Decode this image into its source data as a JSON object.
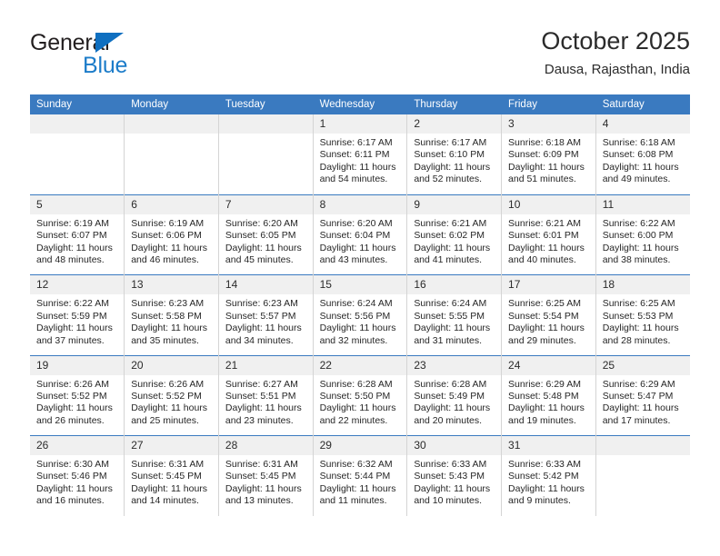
{
  "brand": {
    "name_top": "General",
    "name_bottom": "Blue",
    "triangle_color": "#0f6fc0",
    "text_color": "#231f20",
    "blue_text_color": "#1c7cc9"
  },
  "header": {
    "title": "October 2025",
    "subtitle": "Dausa, Rajasthan, India"
  },
  "theme": {
    "header_row_bg": "#3a7ac0",
    "header_row_text": "#ffffff",
    "daynum_bg": "#f0f0f0",
    "cell_bg": "#ffffff",
    "row_separator": "#3a7ac0",
    "cell_divider": "#d4d4d4"
  },
  "weekday_headers": [
    "Sunday",
    "Monday",
    "Tuesday",
    "Wednesday",
    "Thursday",
    "Friday",
    "Saturday"
  ],
  "labels": {
    "sunrise_prefix": "Sunrise:",
    "sunset_prefix": "Sunset:",
    "daylight_prefix": "Daylight:"
  },
  "weeks": [
    [
      {
        "day": "",
        "empty": true
      },
      {
        "day": "",
        "empty": true
      },
      {
        "day": "",
        "empty": true
      },
      {
        "day": "1",
        "sunrise": "Sunrise: 6:17 AM",
        "sunset": "Sunset: 6:11 PM",
        "daylight": "Daylight: 11 hours and 54 minutes."
      },
      {
        "day": "2",
        "sunrise": "Sunrise: 6:17 AM",
        "sunset": "Sunset: 6:10 PM",
        "daylight": "Daylight: 11 hours and 52 minutes."
      },
      {
        "day": "3",
        "sunrise": "Sunrise: 6:18 AM",
        "sunset": "Sunset: 6:09 PM",
        "daylight": "Daylight: 11 hours and 51 minutes."
      },
      {
        "day": "4",
        "sunrise": "Sunrise: 6:18 AM",
        "sunset": "Sunset: 6:08 PM",
        "daylight": "Daylight: 11 hours and 49 minutes."
      }
    ],
    [
      {
        "day": "5",
        "sunrise": "Sunrise: 6:19 AM",
        "sunset": "Sunset: 6:07 PM",
        "daylight": "Daylight: 11 hours and 48 minutes."
      },
      {
        "day": "6",
        "sunrise": "Sunrise: 6:19 AM",
        "sunset": "Sunset: 6:06 PM",
        "daylight": "Daylight: 11 hours and 46 minutes."
      },
      {
        "day": "7",
        "sunrise": "Sunrise: 6:20 AM",
        "sunset": "Sunset: 6:05 PM",
        "daylight": "Daylight: 11 hours and 45 minutes."
      },
      {
        "day": "8",
        "sunrise": "Sunrise: 6:20 AM",
        "sunset": "Sunset: 6:04 PM",
        "daylight": "Daylight: 11 hours and 43 minutes."
      },
      {
        "day": "9",
        "sunrise": "Sunrise: 6:21 AM",
        "sunset": "Sunset: 6:02 PM",
        "daylight": "Daylight: 11 hours and 41 minutes."
      },
      {
        "day": "10",
        "sunrise": "Sunrise: 6:21 AM",
        "sunset": "Sunset: 6:01 PM",
        "daylight": "Daylight: 11 hours and 40 minutes."
      },
      {
        "day": "11",
        "sunrise": "Sunrise: 6:22 AM",
        "sunset": "Sunset: 6:00 PM",
        "daylight": "Daylight: 11 hours and 38 minutes."
      }
    ],
    [
      {
        "day": "12",
        "sunrise": "Sunrise: 6:22 AM",
        "sunset": "Sunset: 5:59 PM",
        "daylight": "Daylight: 11 hours and 37 minutes."
      },
      {
        "day": "13",
        "sunrise": "Sunrise: 6:23 AM",
        "sunset": "Sunset: 5:58 PM",
        "daylight": "Daylight: 11 hours and 35 minutes."
      },
      {
        "day": "14",
        "sunrise": "Sunrise: 6:23 AM",
        "sunset": "Sunset: 5:57 PM",
        "daylight": "Daylight: 11 hours and 34 minutes."
      },
      {
        "day": "15",
        "sunrise": "Sunrise: 6:24 AM",
        "sunset": "Sunset: 5:56 PM",
        "daylight": "Daylight: 11 hours and 32 minutes."
      },
      {
        "day": "16",
        "sunrise": "Sunrise: 6:24 AM",
        "sunset": "Sunset: 5:55 PM",
        "daylight": "Daylight: 11 hours and 31 minutes."
      },
      {
        "day": "17",
        "sunrise": "Sunrise: 6:25 AM",
        "sunset": "Sunset: 5:54 PM",
        "daylight": "Daylight: 11 hours and 29 minutes."
      },
      {
        "day": "18",
        "sunrise": "Sunrise: 6:25 AM",
        "sunset": "Sunset: 5:53 PM",
        "daylight": "Daylight: 11 hours and 28 minutes."
      }
    ],
    [
      {
        "day": "19",
        "sunrise": "Sunrise: 6:26 AM",
        "sunset": "Sunset: 5:52 PM",
        "daylight": "Daylight: 11 hours and 26 minutes."
      },
      {
        "day": "20",
        "sunrise": "Sunrise: 6:26 AM",
        "sunset": "Sunset: 5:52 PM",
        "daylight": "Daylight: 11 hours and 25 minutes."
      },
      {
        "day": "21",
        "sunrise": "Sunrise: 6:27 AM",
        "sunset": "Sunset: 5:51 PM",
        "daylight": "Daylight: 11 hours and 23 minutes."
      },
      {
        "day": "22",
        "sunrise": "Sunrise: 6:28 AM",
        "sunset": "Sunset: 5:50 PM",
        "daylight": "Daylight: 11 hours and 22 minutes."
      },
      {
        "day": "23",
        "sunrise": "Sunrise: 6:28 AM",
        "sunset": "Sunset: 5:49 PM",
        "daylight": "Daylight: 11 hours and 20 minutes."
      },
      {
        "day": "24",
        "sunrise": "Sunrise: 6:29 AM",
        "sunset": "Sunset: 5:48 PM",
        "daylight": "Daylight: 11 hours and 19 minutes."
      },
      {
        "day": "25",
        "sunrise": "Sunrise: 6:29 AM",
        "sunset": "Sunset: 5:47 PM",
        "daylight": "Daylight: 11 hours and 17 minutes."
      }
    ],
    [
      {
        "day": "26",
        "sunrise": "Sunrise: 6:30 AM",
        "sunset": "Sunset: 5:46 PM",
        "daylight": "Daylight: 11 hours and 16 minutes."
      },
      {
        "day": "27",
        "sunrise": "Sunrise: 6:31 AM",
        "sunset": "Sunset: 5:45 PM",
        "daylight": "Daylight: 11 hours and 14 minutes."
      },
      {
        "day": "28",
        "sunrise": "Sunrise: 6:31 AM",
        "sunset": "Sunset: 5:45 PM",
        "daylight": "Daylight: 11 hours and 13 minutes."
      },
      {
        "day": "29",
        "sunrise": "Sunrise: 6:32 AM",
        "sunset": "Sunset: 5:44 PM",
        "daylight": "Daylight: 11 hours and 11 minutes."
      },
      {
        "day": "30",
        "sunrise": "Sunrise: 6:33 AM",
        "sunset": "Sunset: 5:43 PM",
        "daylight": "Daylight: 11 hours and 10 minutes."
      },
      {
        "day": "31",
        "sunrise": "Sunrise: 6:33 AM",
        "sunset": "Sunset: 5:42 PM",
        "daylight": "Daylight: 11 hours and 9 minutes."
      },
      {
        "day": "",
        "empty": true
      }
    ]
  ]
}
